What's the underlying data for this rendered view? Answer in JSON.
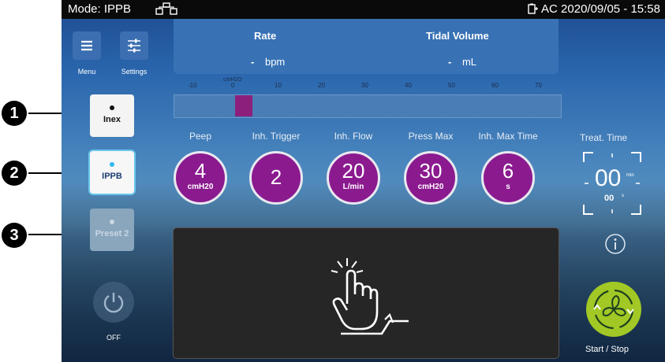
{
  "status": {
    "mode": "Mode: IPPB",
    "right_text": "AC 2020/09/05 - 15:58",
    "icons": [
      "network-icon",
      "battery-plug-icon"
    ]
  },
  "side": {
    "menu_label": "Menu",
    "settings_label": "Settings",
    "off_label": "OFF"
  },
  "modes": [
    {
      "label": "Inex",
      "dot_color": "#111111"
    },
    {
      "label": "IPPB",
      "dot_color": "#2fb7ef"
    },
    {
      "label": "Preset 2",
      "dot_color": "#c8d7e3"
    }
  ],
  "callouts": [
    "1",
    "2",
    "3"
  ],
  "readout": {
    "rate_label": "Rate",
    "rate_value": "-",
    "rate_unit": "bpm",
    "tidal_label": "Tidal Volume",
    "tidal_value": "-",
    "tidal_unit": "mL"
  },
  "scale": {
    "unit": "cmH2O",
    "ticks": [
      "-10",
      "0",
      "10",
      "20",
      "30",
      "40",
      "50",
      "60",
      "70"
    ],
    "marker_value": 0
  },
  "params": [
    {
      "label": "Peep",
      "value": "4",
      "unit": "cmH20"
    },
    {
      "label": "Inh. Trigger",
      "value": "2",
      "unit": ""
    },
    {
      "label": "Inh. Flow",
      "value": "20",
      "unit": "L/min"
    },
    {
      "label": "Press Max",
      "value": "30",
      "unit": "cmH20"
    },
    {
      "label": "Inh. Max Time",
      "value": "6",
      "unit": "s"
    }
  ],
  "treat": {
    "label": "Treat. Time",
    "minutes": "00",
    "min_unit": "min",
    "seconds": "00",
    "sec_unit": "s"
  },
  "start": {
    "label": "Start / Stop"
  },
  "colors": {
    "param_circle": "#8b1a8f",
    "start_button": "#a1c825",
    "readout_panel": "#3872b5",
    "active_mode_glow": "#6cc5ee"
  }
}
